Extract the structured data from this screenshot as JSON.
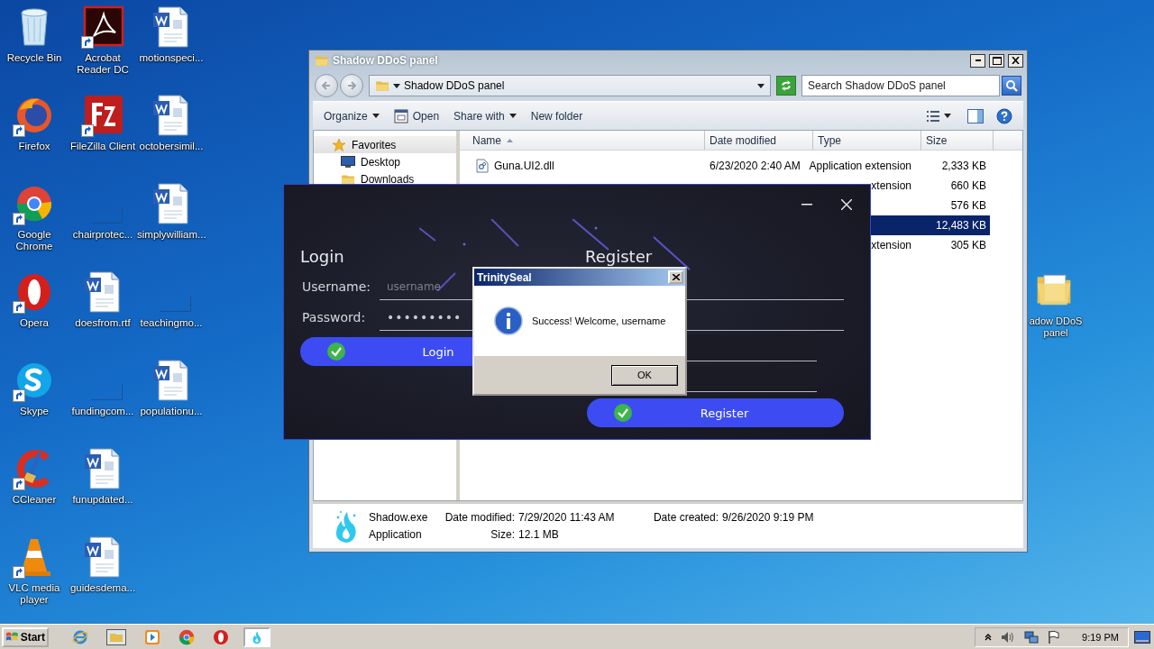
{
  "desktop_icons": [
    {
      "label": "Recycle Bin",
      "kind": "recycle",
      "shortcut": false
    },
    {
      "label": "Firefox",
      "kind": "firefox",
      "shortcut": true
    },
    {
      "label": "Google Chrome",
      "kind": "chrome",
      "shortcut": true
    },
    {
      "label": "Opera",
      "kind": "opera",
      "shortcut": true
    },
    {
      "label": "Skype",
      "kind": "skype",
      "shortcut": true
    },
    {
      "label": "CCleaner",
      "kind": "ccleaner",
      "shortcut": true
    },
    {
      "label": "VLC media player",
      "kind": "vlc",
      "shortcut": true
    },
    {
      "label": "Acrobat Reader DC",
      "kind": "acrobat",
      "shortcut": true
    },
    {
      "label": "FileZilla Client",
      "kind": "filezilla",
      "shortcut": true
    },
    {
      "label": "chairprotec...",
      "kind": "blank",
      "shortcut": false
    },
    {
      "label": "doesfrom.rtf",
      "kind": "word",
      "shortcut": false
    },
    {
      "label": "fundingcom...",
      "kind": "blank",
      "shortcut": false
    },
    {
      "label": "funupdated...",
      "kind": "word",
      "shortcut": false
    },
    {
      "label": "guidesdema...",
      "kind": "word",
      "shortcut": false
    },
    {
      "label": "motionspeci...",
      "kind": "word",
      "shortcut": false
    },
    {
      "label": "octobersimil...",
      "kind": "word",
      "shortcut": false
    },
    {
      "label": "simplywilliam...",
      "kind": "word",
      "shortcut": false
    },
    {
      "label": "teachingmo...",
      "kind": "blank",
      "shortcut": false
    },
    {
      "label": "populationu...",
      "kind": "word",
      "shortcut": false
    }
  ],
  "desktop_icons_right": [
    {
      "label": "adow DDoS panel",
      "kind": "folder",
      "shortcut": false
    }
  ],
  "explorer": {
    "title": "Shadow DDoS panel",
    "address": "Shadow DDoS panel",
    "search": {
      "placeholder": "Search Shadow DDoS panel"
    },
    "toolbar": [
      {
        "label": "Organize",
        "kind": "menu"
      },
      {
        "label": "Open",
        "kind": "open"
      },
      {
        "label": "Share with",
        "kind": "menu"
      },
      {
        "label": "New folder",
        "kind": "plain"
      }
    ],
    "nav": [
      {
        "label": "Favorites",
        "kind": "favorites",
        "selected": true
      },
      {
        "label": "Desktop",
        "kind": "desktop",
        "selected": false
      },
      {
        "label": "Downloads",
        "kind": "downloads",
        "selected": false
      }
    ],
    "columns": [
      {
        "label": "Name",
        "sorted": true
      },
      {
        "label": "Date modified",
        "sorted": false
      },
      {
        "label": "Type",
        "sorted": false
      },
      {
        "label": "Size",
        "sorted": false
      }
    ],
    "rows": [
      {
        "name": "Guna.UI2.dll",
        "date_modified": "6/23/2020 2:40 AM",
        "type": "Application extension",
        "size": "2,333 KB",
        "selected": false
      },
      {
        "type": "xtension",
        "size": "660 KB",
        "selected": false
      },
      {
        "size": "576 KB",
        "selected": false
      },
      {
        "size": "12,483 KB",
        "selected": true
      },
      {
        "type": "xtension",
        "size": "305 KB",
        "selected": false
      }
    ],
    "details": {
      "name": "Shadow.exe",
      "type": "Application",
      "date_modified": {
        "label": "Date modified:",
        "value": "7/29/2020 11:43 AM"
      },
      "date_created": {
        "label": "Date created:",
        "value": "9/26/2020 9:19 PM"
      },
      "size": {
        "label": "Size:",
        "value": "12.1 MB"
      }
    }
  },
  "app_window": {
    "login": {
      "title": "Login",
      "fields": [
        {
          "label": "Username:",
          "placeholder": "username",
          "kind": "text"
        },
        {
          "label": "Password:",
          "value": "•••••••••",
          "kind": "password"
        }
      ],
      "button": "Login"
    },
    "register": {
      "title": "Register",
      "fields": [
        {
          "kind": "wide"
        },
        {
          "kind": "wide"
        },
        {
          "kind": "short"
        },
        {
          "kind": "short"
        }
      ],
      "button": "Register"
    }
  },
  "dialog": {
    "title": "TrinitySeal",
    "message": "Success! Welcome, username",
    "button": "OK"
  },
  "taskbar": {
    "start": "Start",
    "apps": [
      {
        "kind": "ie",
        "selected": false
      },
      {
        "kind": "explorer",
        "selected": false
      },
      {
        "kind": "media",
        "selected": false
      },
      {
        "kind": "chrome",
        "selected": false
      },
      {
        "kind": "opera",
        "selected": false
      },
      {
        "kind": "shadow",
        "selected": true
      }
    ],
    "tray": [
      {
        "kind": "caret"
      },
      {
        "kind": "speaker"
      },
      {
        "kind": "network"
      },
      {
        "kind": "flag"
      }
    ],
    "clock": "9:19 PM"
  }
}
